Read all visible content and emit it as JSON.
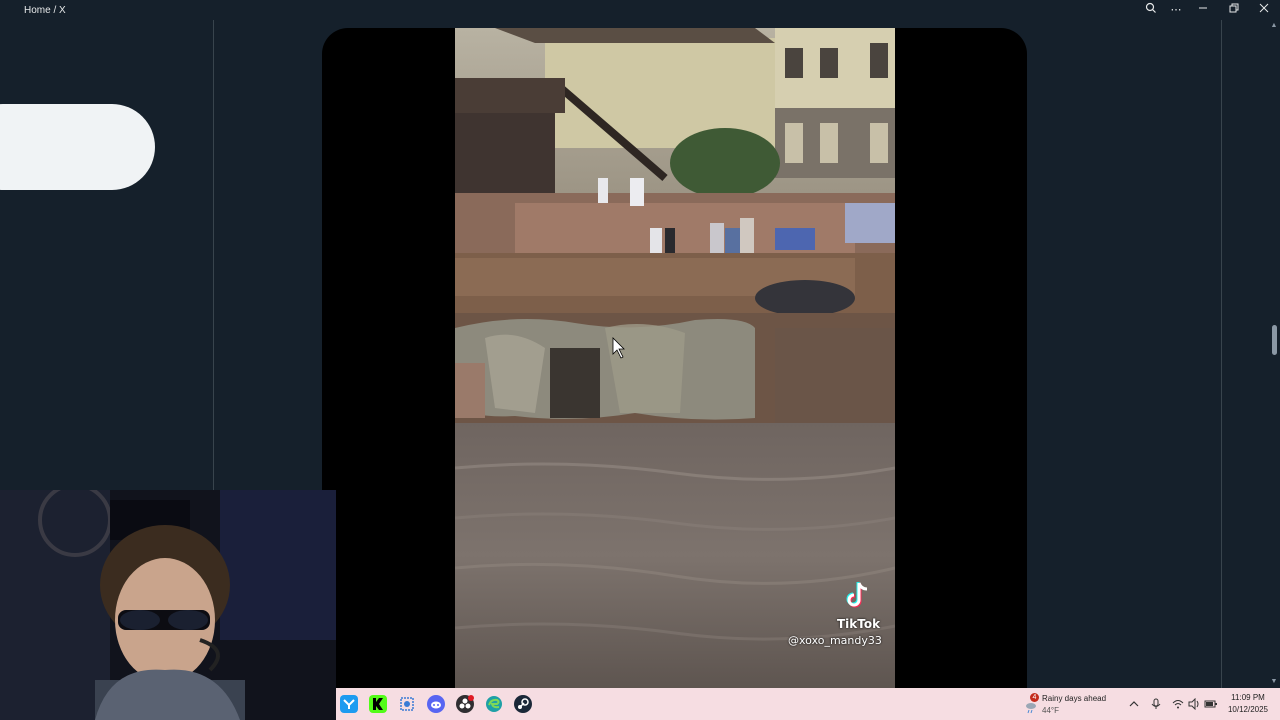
{
  "window": {
    "title": "Home / X",
    "controls": [
      "zoom-icon",
      "more-icon",
      "minimize-icon",
      "restore-icon",
      "close-icon"
    ]
  },
  "video": {
    "watermark": "TikTok",
    "username": "@xoxo_mandy33"
  },
  "taskbar": {
    "apps": [
      "twitter-icon",
      "kick-icon",
      "snipping-tool-icon",
      "discord-icon",
      "obs-icon",
      "edge-icon",
      "steam-icon"
    ],
    "weather": {
      "badge": "4",
      "text": "Rainy days ahead",
      "temp": "44°F"
    },
    "clock": {
      "time": "11:09 PM",
      "date": "10/12/2025"
    }
  },
  "colors": {
    "background": "#15202b",
    "taskbar": "#f6dde2",
    "accent_twitter": "#1d9bf0",
    "accent_kick": "#53fc18"
  }
}
